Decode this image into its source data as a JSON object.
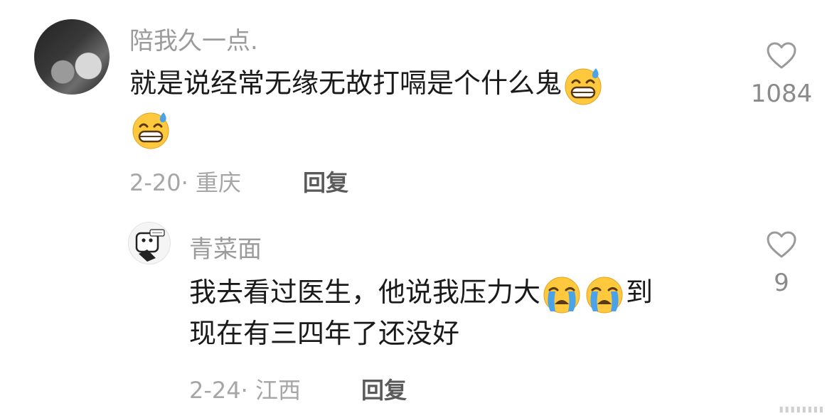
{
  "comments": [
    {
      "username": "陪我久一点.",
      "text_line1": "就是说经常无缘无故打嗝是个什么鬼",
      "emoji_1": "grinning-sweat-emoji",
      "emoji_2": "grinning-sweat-emoji",
      "date_location": "2-20· 重庆",
      "reply_label": "回复",
      "likes": "1084"
    },
    {
      "username": "青菜面",
      "text_line1": "我去看过医生，他说我压力大",
      "emoji_1": "loudly-crying-emoji",
      "emoji_2": "loudly-crying-emoji",
      "text_line1_end": "到",
      "text_line2": "现在有三四年了还没好",
      "date_location": "2-24· 江西",
      "reply_label": "回复",
      "likes": "9"
    }
  ],
  "icons": {
    "like": "heart-outline-icon"
  },
  "colors": {
    "username": "#9b9b9b",
    "text": "#1a1a1a",
    "meta": "#a6a6a6",
    "reply": "#5a5a5a"
  }
}
